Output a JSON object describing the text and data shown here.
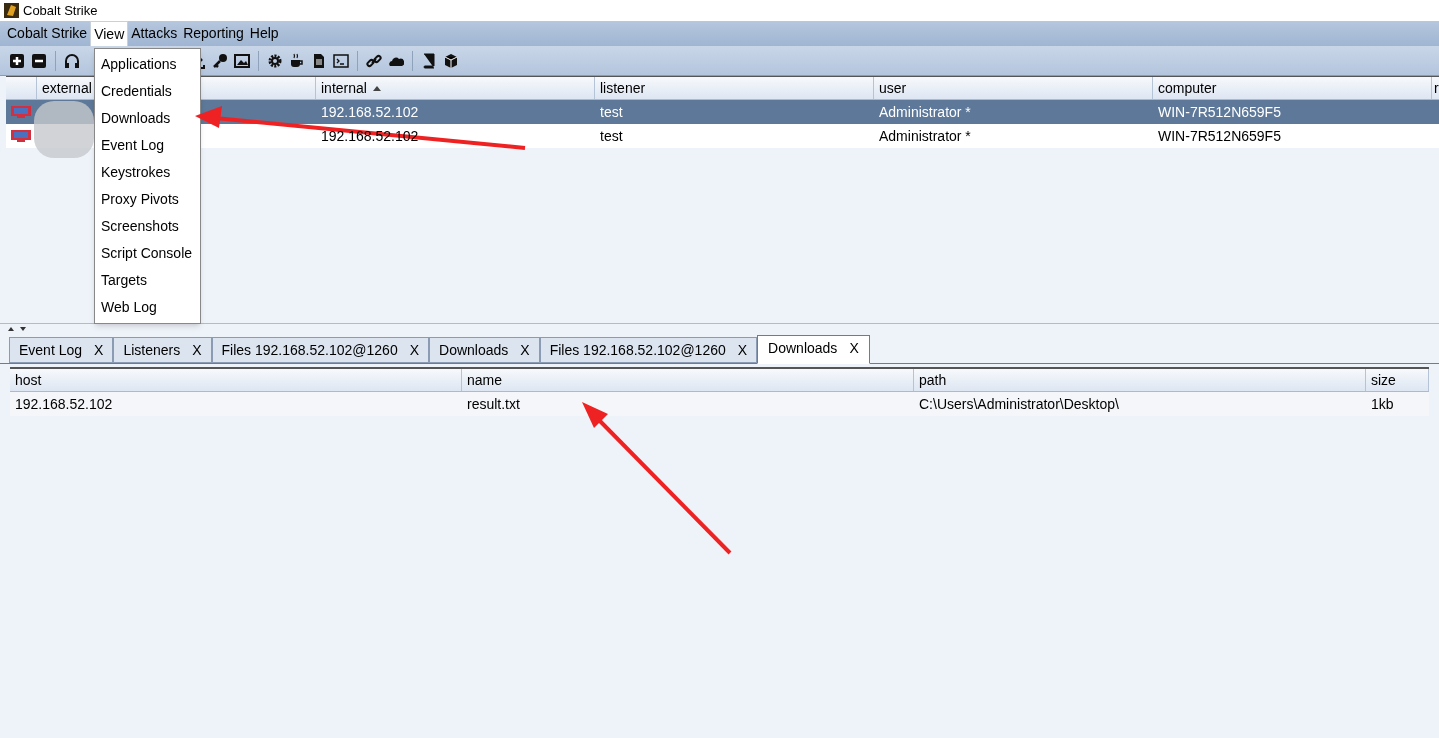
{
  "window": {
    "title": "Cobalt Strike"
  },
  "menubar": [
    {
      "label": "Cobalt Strike",
      "selected": false
    },
    {
      "label": "View",
      "selected": true
    },
    {
      "label": "Attacks",
      "selected": false
    },
    {
      "label": "Reporting",
      "selected": false
    },
    {
      "label": "Help",
      "selected": false
    }
  ],
  "view_menu": [
    "Applications",
    "Credentials",
    "Downloads",
    "Event Log",
    "Keystrokes",
    "Proxy Pivots",
    "Screenshots",
    "Script Console",
    "Targets",
    "Web Log"
  ],
  "sessions": {
    "columns": [
      {
        "label": "external",
        "sorted": false
      },
      {
        "label": "internal",
        "sorted": true
      },
      {
        "label": "listener",
        "sorted": false
      },
      {
        "label": "user",
        "sorted": false
      },
      {
        "label": "computer",
        "sorted": false
      },
      {
        "label": "r",
        "sorted": false
      }
    ],
    "rows": [
      {
        "selected": true,
        "cells": [
          "",
          "192.168.52.102",
          "test",
          "Administrator *",
          "WIN-7R512N659F5"
        ]
      },
      {
        "selected": false,
        "cells": [
          "",
          "192.168.52.102",
          "test",
          "Administrator *",
          "WIN-7R512N659F5"
        ]
      }
    ]
  },
  "tabs": [
    {
      "label": "Event Log",
      "close": "X",
      "selected": false
    },
    {
      "label": "Listeners",
      "close": "X",
      "selected": false
    },
    {
      "label": "Files 192.168.52.102@1260",
      "close": "X",
      "selected": false
    },
    {
      "label": "Downloads",
      "close": "X",
      "selected": false
    },
    {
      "label": "Files 192.168.52.102@1260",
      "close": "X",
      "selected": false
    },
    {
      "label": "Downloads",
      "close": "X",
      "selected": true
    }
  ],
  "downloads": {
    "columns": [
      "host",
      "name",
      "path",
      "size"
    ],
    "rows": [
      [
        "192.168.52.102",
        "result.txt",
        "C:\\Users\\Administrator\\Desktop\\",
        "1kb"
      ]
    ]
  }
}
